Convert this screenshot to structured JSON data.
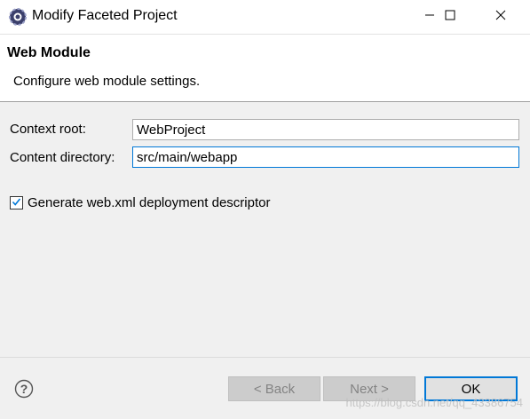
{
  "window": {
    "title": "Modify Faceted Project",
    "minimize_icon": "minimize-icon",
    "maximize_icon": "maximize-icon",
    "close_icon": "close-icon"
  },
  "header": {
    "title": "Web Module",
    "description": "Configure web module settings."
  },
  "form": {
    "context_root_label": "Context root:",
    "context_root_value": "WebProject",
    "content_directory_label": "Content directory:",
    "content_directory_value": "src/main/webapp",
    "generate_descriptor_label": "Generate web.xml deployment descriptor",
    "generate_descriptor_checked": true
  },
  "footer": {
    "help_icon": "help-icon",
    "back_label": "< Back",
    "next_label": "Next >",
    "ok_label": "OK"
  },
  "watermark": "https://blog.csdn.net/qq_43386754",
  "colors": {
    "accent": "#0078d7",
    "window_bg": "#f0f0f0",
    "banner_bg": "#ffffff"
  }
}
